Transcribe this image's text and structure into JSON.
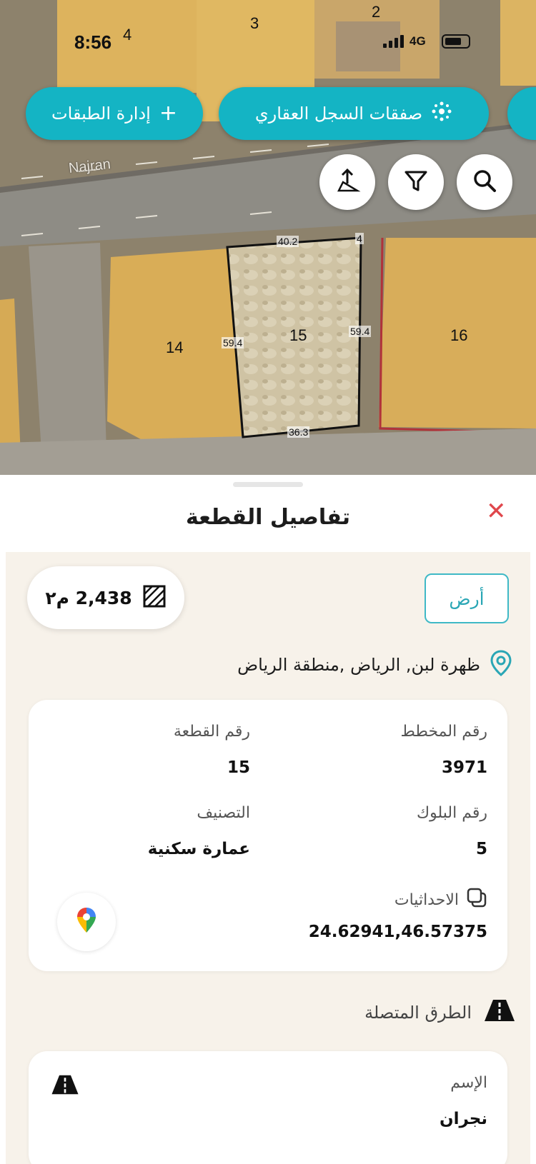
{
  "status_bar": {
    "time": "8:56",
    "network": "4G"
  },
  "map": {
    "road_name": "Najran",
    "background_lots": [
      "4",
      "3",
      "2"
    ],
    "lots": {
      "left": "14",
      "selected": "15",
      "right": "16"
    },
    "corner_marker": "4",
    "dimensions": {
      "top": "40.2",
      "left": "59.4",
      "right": "59.4",
      "bottom": "36.3"
    },
    "pills": {
      "layers": "إدارة الطبقات",
      "transactions": "صفقات السجل العقاري"
    },
    "icons": {
      "layers_button": "plus-icon",
      "transactions_button": "sparkle-icon",
      "share": "share-upload-icon",
      "filter": "filter-icon",
      "search": "search-icon"
    }
  },
  "sheet": {
    "title": "تفاصيل القطعة",
    "property_type": "أرض",
    "area": "2,438 م٢",
    "location": "ظهرة لبن, الرياض ,منطقة الرياض",
    "details": {
      "plan_number_label": "رقم المخطط",
      "plan_number_value": "3971",
      "plot_number_label": "رقم القطعة",
      "plot_number_value": "15",
      "block_number_label": "رقم البلوك",
      "block_number_value": "5",
      "classification_label": "التصنيف",
      "classification_value": "عمارة سكنية",
      "coordinates_label": "الاحداثيات",
      "coordinates_value": "24.62941,46.57375"
    },
    "connected_roads": {
      "title": "الطرق المتصلة",
      "roads": [
        {
          "name_label": "الإسم",
          "name_value": "نجران"
        }
      ]
    }
  },
  "colors": {
    "accent": "#14b4c4",
    "close": "#e0474c",
    "selected_lot_border": "#111111",
    "neighbour_lot_border": "#b0323a"
  }
}
